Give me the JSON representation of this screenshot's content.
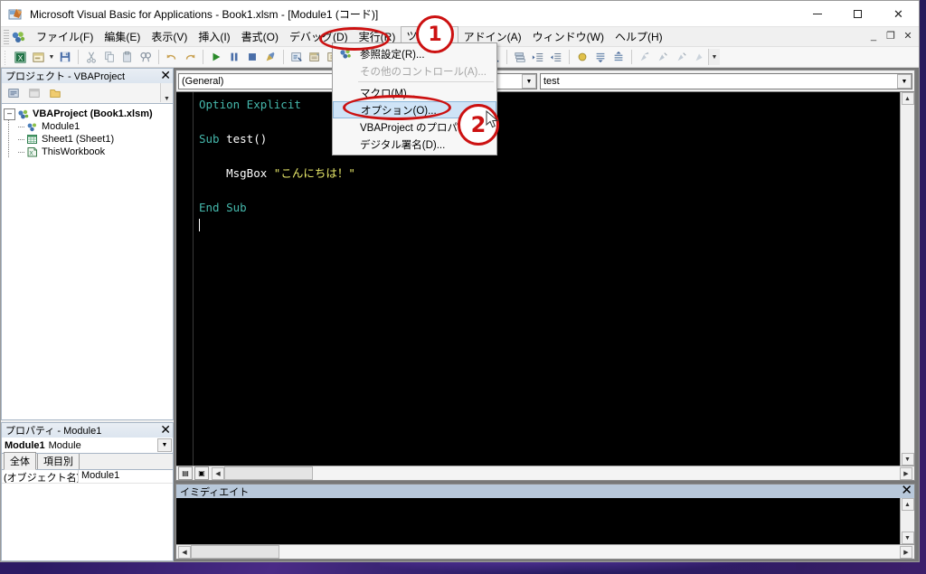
{
  "window": {
    "title": "Microsoft Visual Basic for Applications - Book1.xlsm - [Module1 (コード)]",
    "icon": "vba-app-icon",
    "controls": {
      "minimize": "–",
      "maximize": "□",
      "close": "✕"
    },
    "mdi_controls": {
      "minimize": "_",
      "restore": "❐",
      "close": "✕"
    }
  },
  "menubar": {
    "icon": "vba-logo-icon",
    "items": [
      {
        "label": "ファイル(F)",
        "open": false
      },
      {
        "label": "編集(E)",
        "open": false
      },
      {
        "label": "表示(V)",
        "open": false
      },
      {
        "label": "挿入(I)",
        "open": false
      },
      {
        "label": "書式(O)",
        "open": false
      },
      {
        "label": "デバッグ(D)",
        "open": false
      },
      {
        "label": "実行(R)",
        "open": false
      },
      {
        "label": "ツール(T)",
        "open": true
      },
      {
        "label": "アドイン(A)",
        "open": false
      },
      {
        "label": "ウィンドウ(W)",
        "open": false
      },
      {
        "label": "ヘルプ(H)",
        "open": false
      }
    ]
  },
  "tools_menu": {
    "items": [
      {
        "label": "参照設定(R)...",
        "icon": "references-icon",
        "state": "normal"
      },
      {
        "label": "その他のコントロール(A)...",
        "icon": "",
        "state": "disabled"
      },
      {
        "label": "マクロ(M)...",
        "icon": "",
        "state": "normal"
      },
      {
        "label": "オプション(O)...",
        "icon": "",
        "state": "selected"
      },
      {
        "label": "VBAProject のプロパティ(E)...",
        "icon": "",
        "state": "normal"
      },
      {
        "label": "デジタル署名(D)...",
        "icon": "",
        "state": "normal"
      }
    ]
  },
  "toolbar": {
    "buttons": [
      {
        "name": "view-excel-icon"
      },
      {
        "name": "insert-userform-icon"
      },
      {
        "name": "insert-dropdown-arrow"
      },
      {
        "name": "save-icon"
      },
      {
        "name": "cut-icon"
      },
      {
        "name": "copy-icon"
      },
      {
        "name": "paste-icon"
      },
      {
        "name": "find-icon"
      },
      {
        "name": "undo-icon"
      },
      {
        "name": "redo-icon"
      },
      {
        "name": "run-icon"
      },
      {
        "name": "break-icon"
      },
      {
        "name": "reset-icon"
      },
      {
        "name": "design-mode-icon"
      },
      {
        "name": "project-explorer-icon"
      },
      {
        "name": "properties-window-icon"
      },
      {
        "name": "object-browser-icon"
      }
    ]
  },
  "project_panel": {
    "title": "プロジェクト - VBAProject",
    "close_label": "✕",
    "toolbar": [
      "view-code-icon",
      "view-object-icon",
      "toggle-folders-icon"
    ],
    "tree": [
      {
        "label": "VBAProject (Book1.xlsm)",
        "level": 0,
        "expander": "–",
        "icon": "project-icon"
      },
      {
        "label": "Module1",
        "level": 1,
        "expander": "",
        "icon": "module-icon"
      },
      {
        "label": "Sheet1 (Sheet1)",
        "level": 1,
        "expander": "",
        "icon": "sheet-icon"
      },
      {
        "label": "ThisWorkbook",
        "level": 1,
        "expander": "",
        "icon": "workbook-icon"
      }
    ]
  },
  "properties_panel": {
    "title": "プロパティ - Module1",
    "close_label": "✕",
    "selected_object": "Module1",
    "selected_object_type": "Module",
    "tabs": [
      {
        "label": "全体",
        "active": true
      },
      {
        "label": "項目別",
        "active": false
      }
    ],
    "rows": [
      {
        "key": "(オブジェクト名)",
        "value": "Module1"
      }
    ]
  },
  "code_window": {
    "object_combo": "(General)",
    "proc_combo": "test",
    "lines": [
      [
        {
          "t": "Option Explicit",
          "c": "kw"
        }
      ],
      [],
      [
        {
          "t": "Sub ",
          "c": "kw"
        },
        {
          "t": "test()",
          "c": "idf"
        }
      ],
      [],
      [
        {
          "t": "    MsgBox ",
          "c": "idf"
        },
        {
          "t": "\"こんにちは！\"",
          "c": "str"
        }
      ],
      [],
      [
        {
          "t": "End Sub",
          "c": "kw"
        }
      ]
    ]
  },
  "immediate_window": {
    "title": "イミディエイト",
    "close_label": "✕",
    "content": ""
  },
  "annotations": [
    {
      "name": "step-1-marker",
      "number": "1",
      "target": "ツール(T)"
    },
    {
      "name": "step-2-marker",
      "number": "2",
      "target": "オプション(O)..."
    }
  ],
  "colors": {
    "annotation_red": "#cc1111",
    "code_background": "#000000",
    "code_keyword": "#45b8ac",
    "code_string": "#e8e86a",
    "code_identifier": "#ffffff",
    "menu_highlight": "#cfe4f7",
    "immediate_header": "#b8c8da"
  }
}
